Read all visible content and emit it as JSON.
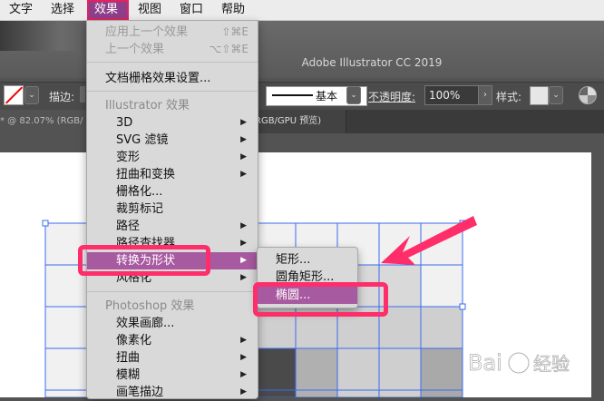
{
  "menubar": {
    "items": [
      {
        "label": "文字"
      },
      {
        "label": "选择"
      },
      {
        "label": "效果"
      },
      {
        "label": "视图"
      },
      {
        "label": "窗口"
      },
      {
        "label": "帮助"
      }
    ]
  },
  "titlebar": {
    "title": "Adobe Illustrator CC 2019"
  },
  "controlbar": {
    "stroke_label": "描边:",
    "stroke_style": "基本",
    "opacity_label": "不透明度:",
    "opacity_value": "100%",
    "style_label": "样式:",
    "dropdown_glyph": "⌄",
    "arrow_glyph": "›"
  },
  "tabs": {
    "doc1": "* @ 82.07% (RGB/",
    "doc2": "RGB/GPU 预览)"
  },
  "effect_menu": {
    "apply_last": {
      "label": "应用上一个效果",
      "shortcut": "⇧⌘E"
    },
    "last": {
      "label": "上一个效果",
      "shortcut": "⌥⇧⌘E"
    },
    "doc_raster": {
      "label": "文档栅格效果设置..."
    },
    "illustrator_header": "Illustrator 效果",
    "illustrator_items": [
      {
        "label": "3D",
        "arrow": "▶"
      },
      {
        "label": "SVG 滤镜",
        "arrow": "▶"
      },
      {
        "label": "变形",
        "arrow": "▶"
      },
      {
        "label": "扭曲和变换",
        "arrow": "▶"
      },
      {
        "label": "栅格化...",
        "arrow": ""
      },
      {
        "label": "裁剪标记",
        "arrow": ""
      },
      {
        "label": "路径",
        "arrow": "▶"
      },
      {
        "label": "路径查找器",
        "arrow": "▶"
      },
      {
        "label": "转换为形状",
        "arrow": "▶"
      },
      {
        "label": "风格化",
        "arrow": "▶"
      }
    ],
    "photoshop_header": "Photoshop 效果",
    "photoshop_items": [
      {
        "label": "效果画廊...",
        "arrow": ""
      },
      {
        "label": "像素化",
        "arrow": "▶"
      },
      {
        "label": "扭曲",
        "arrow": "▶"
      },
      {
        "label": "模糊",
        "arrow": "▶"
      },
      {
        "label": "画笔描边",
        "arrow": "▶"
      }
    ]
  },
  "submenu": {
    "items": [
      {
        "label": "矩形..."
      },
      {
        "label": "圆角矩形..."
      },
      {
        "label": "椭圆..."
      }
    ]
  },
  "colors": {
    "menu_highlight": "#a85aa0",
    "annotation": "#ff2d6a",
    "selection_blue": "#3a6cf0"
  }
}
